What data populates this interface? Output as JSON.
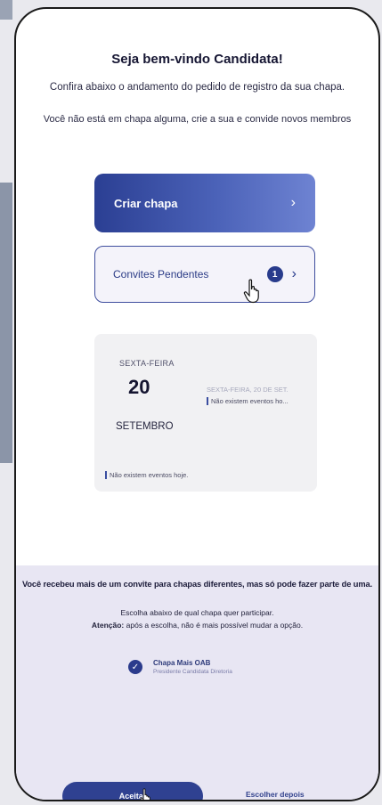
{
  "header": {
    "title": "Seja bem-vindo Candidata!",
    "subtitle": "Confira abaixo o andamento do pedido de registro da sua chapa.",
    "notice": "Você não está em chapa alguma, crie a sua e convide novos membros"
  },
  "actions": {
    "create_label": "Criar chapa",
    "invites_label": "Convites Pendentes",
    "invites_count": "1"
  },
  "calendar": {
    "weekday": "SEXTA-FEIRA",
    "day": "20",
    "month": "SETEMBRO",
    "side_date": "SEXTA-FEIRA, 20 DE SET.",
    "side_event": "Não existem eventos ho...",
    "bottom_event": "Não existem eventos hoje."
  },
  "invite_panel": {
    "warning": "Você recebeu mais de um convite para chapas diferentes, mas só pode fazer parte de uma.",
    "instruction": "Escolha abaixo de qual chapa quer participar.",
    "attention_label": "Atenção:",
    "attention_text": "após a escolha, não é mais possível mudar a opção.",
    "option_name": "Chapa Mais OAB",
    "option_desc": "Presidente Candidata Diretoria",
    "accept_label": "Aceitar",
    "later_label": "Escolher depois"
  },
  "colors": {
    "primary": "#2f4191",
    "panel": "#e8e6f3"
  }
}
